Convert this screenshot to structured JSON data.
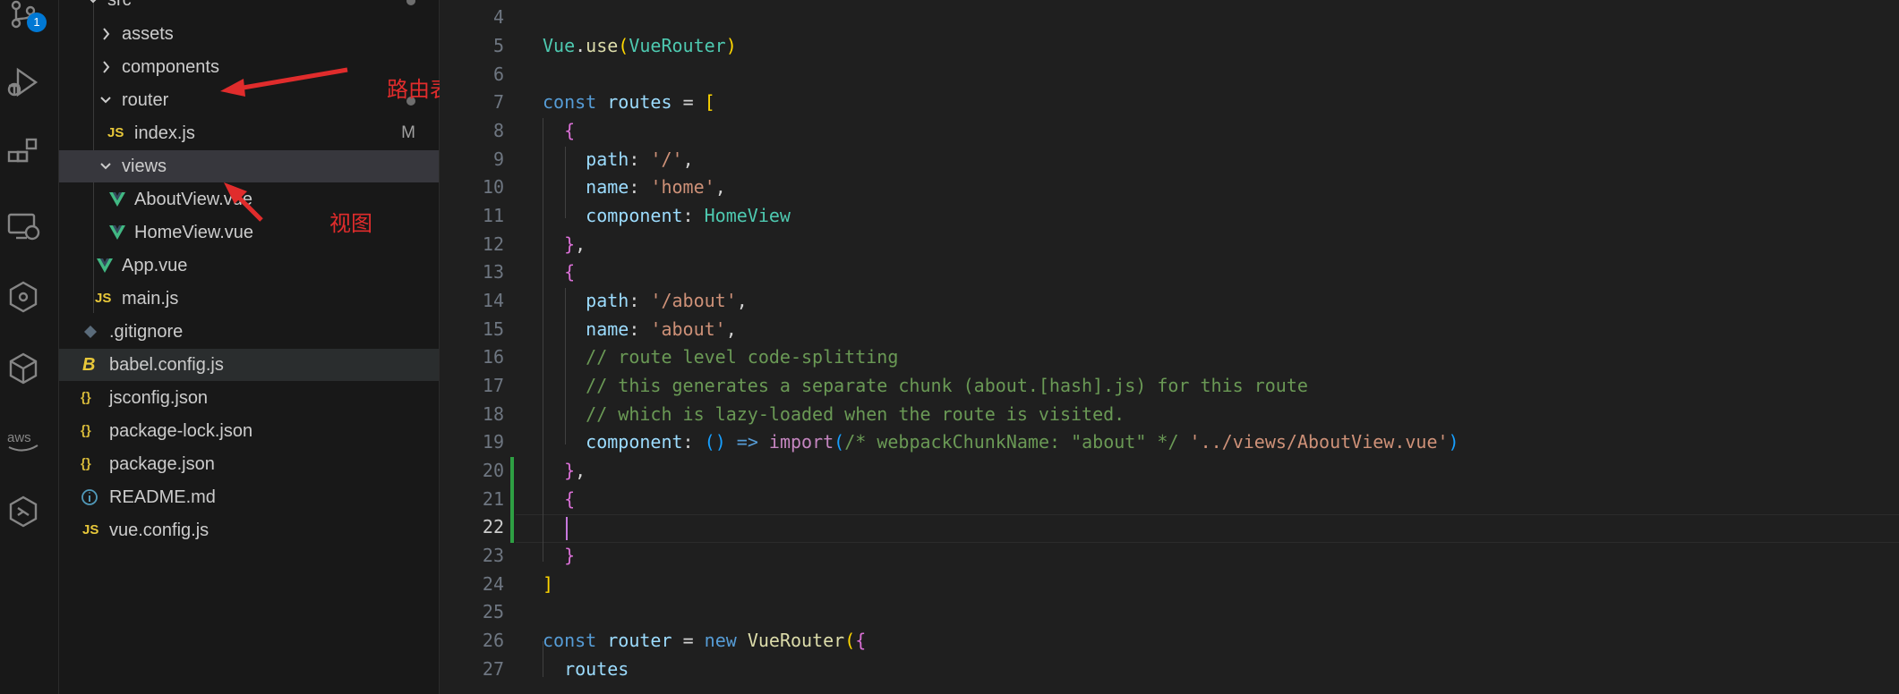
{
  "activity_bar": {
    "items": [
      {
        "name": "source-control",
        "badge": "1"
      },
      {
        "name": "run-and-debug"
      },
      {
        "name": "extensions"
      },
      {
        "name": "remote-explorer"
      },
      {
        "name": "gitlens"
      },
      {
        "name": "packages"
      },
      {
        "name": "aws"
      },
      {
        "name": "hexagon"
      }
    ]
  },
  "explorer": {
    "src_label": "src",
    "items": [
      {
        "label": "assets",
        "type": "folder-collapsed"
      },
      {
        "label": "components",
        "type": "folder-collapsed"
      },
      {
        "label": "router",
        "type": "folder-open"
      },
      {
        "label": "index.js",
        "type": "js",
        "git_status": "M"
      },
      {
        "label": "views",
        "type": "folder-open"
      },
      {
        "label": "AboutView.vue",
        "type": "vue"
      },
      {
        "label": "HomeView.vue",
        "type": "vue"
      },
      {
        "label": "App.vue",
        "type": "vue"
      },
      {
        "label": "main.js",
        "type": "js"
      },
      {
        "label": ".gitignore",
        "type": "git"
      },
      {
        "label": "babel.config.js",
        "type": "babel"
      },
      {
        "label": "jsconfig.json",
        "type": "json"
      },
      {
        "label": "package-lock.json",
        "type": "json"
      },
      {
        "label": "package.json",
        "type": "json"
      },
      {
        "label": "README.md",
        "type": "info"
      },
      {
        "label": "vue.config.js",
        "type": "js"
      }
    ]
  },
  "annotations": {
    "router_note": "路由表",
    "views_note": "视图"
  },
  "editor": {
    "active_line": 22,
    "line_numbers": [
      "4",
      "5",
      "6",
      "7",
      "8",
      "9",
      "10",
      "11",
      "12",
      "13",
      "14",
      "15",
      "16",
      "17",
      "18",
      "19",
      "20",
      "21",
      "22",
      "23",
      "24",
      "25",
      "26",
      "27"
    ],
    "lines": [
      "",
      "Vue.use(VueRouter)",
      "",
      "const routes = [",
      "  {",
      "    path: '/',",
      "    name: 'home',",
      "    component: HomeView",
      "  },",
      "  {",
      "    path: '/about',",
      "    name: 'about',",
      "    // route level code-splitting",
      "    // this generates a separate chunk (about.[hash].js) for this route",
      "    // which is lazy-loaded when the route is visited.",
      "    component: () => import(/* webpackChunkName: \"about\" */ '../views/AboutView.vue')",
      "  },",
      "  {",
      "    ",
      "  }",
      "]",
      "",
      "const router = new VueRouter({",
      "  routes"
    ]
  },
  "colors": {
    "keyword": "#569cd6",
    "variable": "#9cdcfe",
    "function": "#dcdcaa",
    "type": "#4ec9b0",
    "string": "#ce9178",
    "comment": "#6a9955",
    "annotation_red": "#e02c2c",
    "git_added": "#2ea043"
  }
}
